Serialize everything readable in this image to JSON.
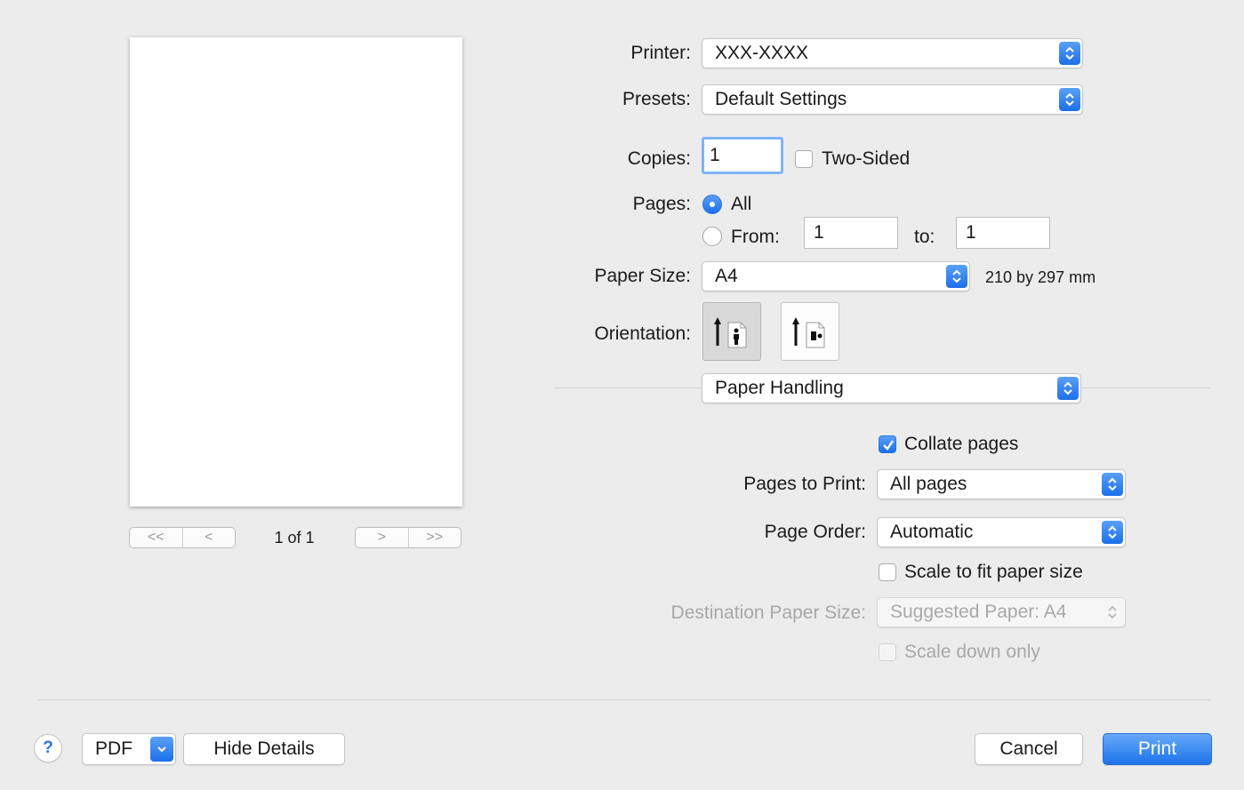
{
  "preview": {
    "page_count": "1 of 1",
    "first_glyph": "<<",
    "prev_glyph": "<",
    "next_glyph": ">",
    "last_glyph": ">>"
  },
  "printer": {
    "label": "Printer:",
    "value": "XXX-XXXX"
  },
  "presets": {
    "label": "Presets:",
    "value": "Default Settings"
  },
  "copies": {
    "label": "Copies:",
    "value": "1",
    "two_sided_label": "Two-Sided",
    "two_sided_checked": false
  },
  "pages": {
    "label": "Pages:",
    "all_label": "All",
    "from_label": "From:",
    "from_value": "1",
    "to_label": "to:",
    "to_value": "1",
    "selected": "All"
  },
  "paper_size": {
    "label": "Paper Size:",
    "value": "A4",
    "dimensions": "210 by 297 mm"
  },
  "orientation": {
    "label": "Orientation:",
    "selected": "portrait"
  },
  "section": {
    "value": "Paper Handling"
  },
  "paper_handling": {
    "collate_label": "Collate pages",
    "collate_checked": true,
    "pages_to_print_label": "Pages to Print:",
    "pages_to_print_value": "All pages",
    "page_order_label": "Page Order:",
    "page_order_value": "Automatic",
    "scale_fit_label": "Scale to fit paper size",
    "scale_fit_checked": false,
    "dest_paper_label": "Destination Paper Size:",
    "dest_paper_value": "Suggested Paper: A4",
    "scale_down_label": "Scale down only",
    "scale_down_checked": false
  },
  "footer": {
    "help_glyph": "?",
    "pdf_label": "PDF",
    "hide_details_label": "Hide Details",
    "cancel_label": "Cancel",
    "print_label": "Print"
  },
  "colors": {
    "accent": "#1f74ea",
    "background": "#ececec",
    "disabled_text": "#a8a8a8"
  }
}
